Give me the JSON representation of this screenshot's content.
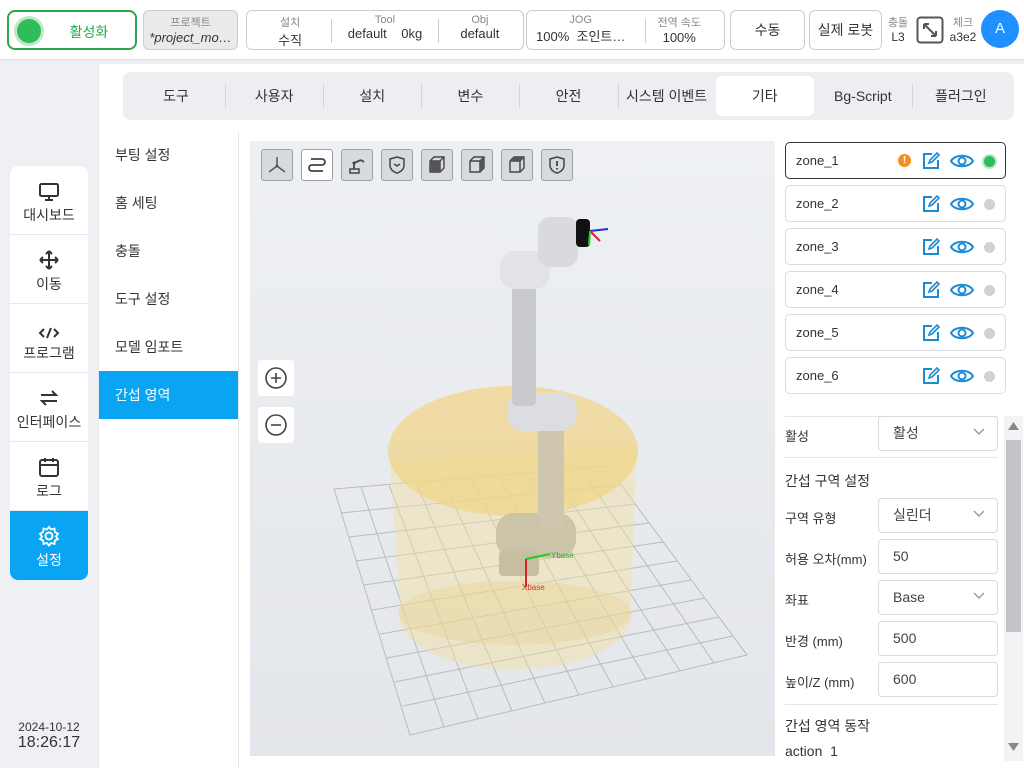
{
  "topbar": {
    "activate_label": "활성화",
    "project": {
      "header": "프로젝트",
      "value": "*project_mo…"
    },
    "install": {
      "header": "설치",
      "value": "수직"
    },
    "tool": {
      "header": "Tool",
      "value": "default",
      "payload": "0kg"
    },
    "obj": {
      "header": "Obj",
      "value": "default"
    },
    "jog": {
      "header": "JOG",
      "value": "100%",
      "mode": "조인트…"
    },
    "global_speed": {
      "header": "전역 속도",
      "value": "100%"
    },
    "mode_label": "수동",
    "real_robot_label": "실제 로봇",
    "collision": {
      "header": "충돌",
      "value": "L3"
    },
    "check": {
      "header": "체크",
      "value": "a3e2"
    },
    "avatar_letter": "A",
    "accent_color": "#0aa5f2",
    "active_color": "#2ebd59"
  },
  "sidebar": {
    "items": [
      {
        "label": "대시보드",
        "icon": "monitor-icon"
      },
      {
        "label": "이동",
        "icon": "move-arrows-icon"
      },
      {
        "label": "프로그램",
        "icon": "code-icon"
      },
      {
        "label": "인터페이스",
        "icon": "exchange-arrows-icon"
      },
      {
        "label": "로그",
        "icon": "calendar-icon"
      },
      {
        "label": "설정",
        "icon": "gear-icon"
      }
    ],
    "date": "2024-10-12",
    "time": "18:26:17"
  },
  "tabs": [
    "도구",
    "사용자",
    "설치",
    "변수",
    "안전",
    "시스템 이벤트",
    "기타",
    "Bg-Script",
    "플러그인"
  ],
  "active_tab": "기타",
  "subnav": [
    "부팅 설정",
    "홈 세팅",
    "충돌",
    "도구 설정",
    "모델 임포트",
    "간섭 영역"
  ],
  "active_subnav": "간섭 영역",
  "view": {
    "toolbar_icons": [
      "axes-view-icon",
      "path-icon",
      "robot-icon",
      "shield-check-icon",
      "cube-front-icon",
      "cube-side-icon",
      "cube-iso-icon",
      "shield-alert-icon"
    ],
    "axis_label_x": "Xbase",
    "axis_label_y": "Ybase"
  },
  "zones": [
    {
      "name": "zone_1",
      "warning": "!",
      "active": true
    },
    {
      "name": "zone_2",
      "active": false
    },
    {
      "name": "zone_3",
      "active": false
    },
    {
      "name": "zone_4",
      "active": false
    },
    {
      "name": "zone_5",
      "active": false
    },
    {
      "name": "zone_6",
      "active": false
    }
  ],
  "props": {
    "enabled_label": "활성",
    "enabled_value": "활성",
    "section_settings": "간섭 구역 설정",
    "zone_type_label": "구역 유형",
    "zone_type_value": "실린더",
    "tolerance_label": "허용 오차(mm)",
    "tolerance_value": "50",
    "coord_label": "좌표",
    "coord_value": "Base",
    "radius_label": "반경 (mm)",
    "radius_value": "500",
    "height_label": "높이/Z (mm)",
    "height_value": "600",
    "section_action": "간섭 영역 동작",
    "action_label": "action",
    "action_value": "1"
  }
}
